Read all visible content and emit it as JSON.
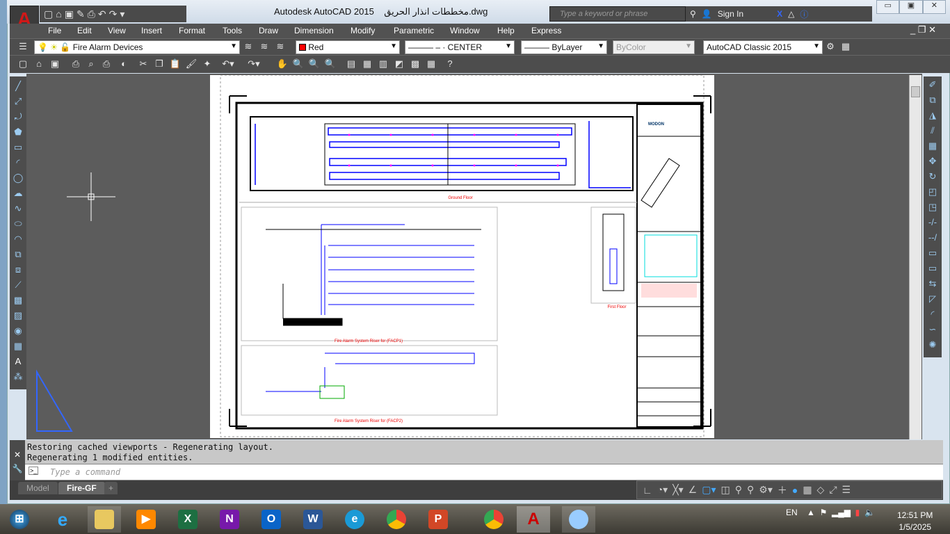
{
  "window": {
    "app_title": "Autodesk AutoCAD 2015",
    "file_name": "مخططات انذار الحريق.dwg"
  },
  "search": {
    "placeholder": "Type a keyword or phrase",
    "sign_in": "Sign In"
  },
  "menu": [
    "File",
    "Edit",
    "View",
    "Insert",
    "Format",
    "Tools",
    "Draw",
    "Dimension",
    "Modify",
    "Parametric",
    "Window",
    "Help",
    "Express"
  ],
  "properties": {
    "layer": "Fire Alarm Devices",
    "color": "Red",
    "color_hex": "#ff0000",
    "linetype": "——— – · CENTER",
    "lineweight": "——— ByLayer",
    "plotstyle": "ByColor",
    "workspace": "AutoCAD Classic 2015"
  },
  "drawing": {
    "ground_floor": "Ground Floor",
    "first_floor": "First Floor",
    "riser1": "Fire Alarm System Riser for (FACP1)",
    "riser2": "Fire Alarm System Riser for (FACP2)",
    "logo": "MODON"
  },
  "command": {
    "history": [
      "Restoring cached viewports - Regenerating layout.",
      "Regenerating 1 modified entities."
    ],
    "placeholder": "Type a command"
  },
  "tabs": {
    "model": "Model",
    "layout": "Fire-GF",
    "add": "+"
  },
  "taskbar": {
    "lang": "EN",
    "time": "12:51 PM",
    "date": "1/5/2025"
  }
}
